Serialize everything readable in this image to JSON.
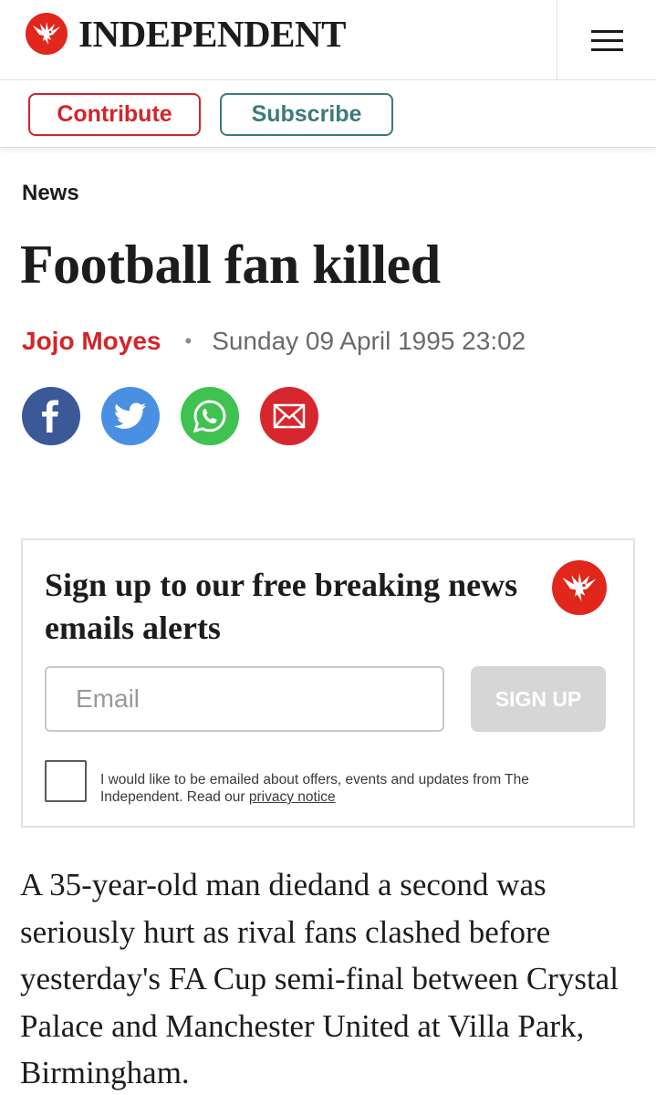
{
  "header": {
    "logo_text": "INDEPENDENT",
    "logo_icon": "eagle-icon",
    "menu_icon": "hamburger-menu-icon",
    "brand_color": "#e1261c"
  },
  "actions": {
    "contribute_label": "Contribute",
    "subscribe_label": "Subscribe",
    "contribute_color": "#d2252a",
    "subscribe_color": "#3d7a7a"
  },
  "article": {
    "section": "News",
    "headline": "Football fan killed",
    "author": "Jojo Moyes",
    "separator": "•",
    "date": "Sunday 09 April 1995 23:02",
    "body": "A 35-year-old man diedand a second was seriously hurt as rival fans clashed before yesterday's FA Cup semi-final between Crystal Palace and Manchester United at Villa Park, Birmingham."
  },
  "share": [
    {
      "name": "facebook-icon",
      "color": "#3b5998"
    },
    {
      "name": "twitter-icon",
      "color": "#4a90e2"
    },
    {
      "name": "whatsapp-icon",
      "color": "#3fc24f"
    },
    {
      "name": "email-icon",
      "color": "#d8262f"
    }
  ],
  "newsletter": {
    "title": "Sign up to our free breaking news emails alerts",
    "email_placeholder": "Email",
    "signup_label": "SIGN UP",
    "consent_text": "I would like to be emailed about offers, events and updates from The Independent. Read our ",
    "privacy_link": "privacy notice"
  }
}
